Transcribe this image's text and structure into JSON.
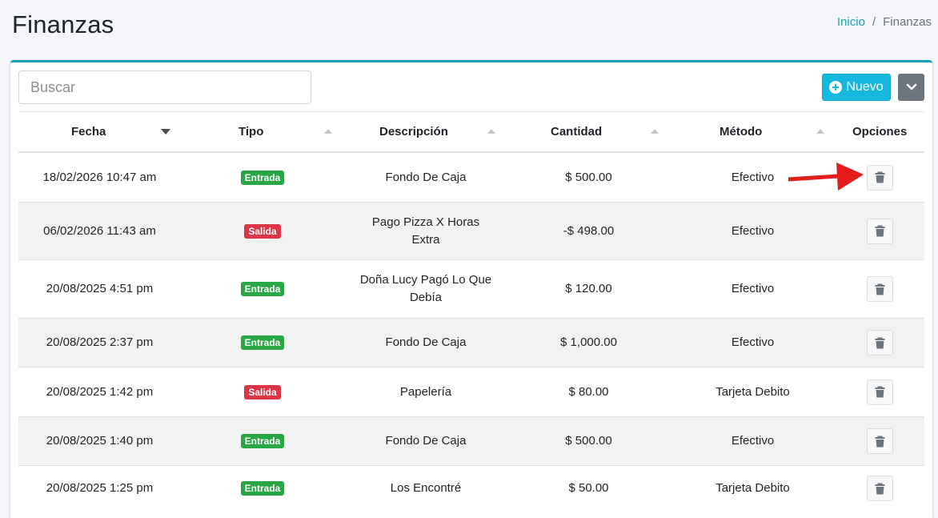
{
  "header": {
    "title": "Finanzas",
    "breadcrumb": {
      "home": "Inicio",
      "separator": "/",
      "current": "Finanzas"
    }
  },
  "toolbar": {
    "search_placeholder": "Buscar",
    "new_label": "Nuevo"
  },
  "table": {
    "columns": [
      "Fecha",
      "Tipo",
      "Descripción",
      "Cantidad",
      "Método",
      "Opciones"
    ],
    "rows": [
      {
        "fecha": "18/02/2026 10:47 am",
        "tipo": "Entrada",
        "descripcion_1": "Fondo De Caja",
        "descripcion_2": "",
        "cantidad": "$ 500.00",
        "metodo": "Efectivo"
      },
      {
        "fecha": "06/02/2026 11:43 am",
        "tipo": "Salida",
        "descripcion_1": "Pago Pizza X Horas",
        "descripcion_2": "Extra",
        "cantidad": "-$ 498.00",
        "metodo": "Efectivo"
      },
      {
        "fecha": "20/08/2025 4:51 pm",
        "tipo": "Entrada",
        "descripcion_1": "Doña Lucy Pagó Lo Que",
        "descripcion_2": "Debía",
        "cantidad": "$ 120.00",
        "metodo": "Efectivo"
      },
      {
        "fecha": "20/08/2025 2:37 pm",
        "tipo": "Entrada",
        "descripcion_1": "Fondo De Caja",
        "descripcion_2": "",
        "cantidad": "$ 1,000.00",
        "metodo": "Efectivo"
      },
      {
        "fecha": "20/08/2025 1:42 pm",
        "tipo": "Salida",
        "descripcion_1": "Papelería",
        "descripcion_2": "",
        "cantidad": "$ 80.00",
        "metodo": "Tarjeta Debito"
      },
      {
        "fecha": "20/08/2025 1:40 pm",
        "tipo": "Entrada",
        "descripcion_1": "Fondo De Caja",
        "descripcion_2": "",
        "cantidad": "$ 500.00",
        "metodo": "Efectivo"
      },
      {
        "fecha": "20/08/2025 1:25 pm",
        "tipo": "Entrada",
        "descripcion_1": "Los Encontré",
        "descripcion_2": "",
        "cantidad": "$ 50.00",
        "metodo": "Tarjeta Debito"
      }
    ]
  },
  "colors": {
    "accent": "#17a2b8",
    "new_button": "#17b8e0",
    "entrada_badge": "#28a745",
    "salida_badge": "#dc3545",
    "dropdown_button": "#6c757d",
    "annotation_arrow": "#e31b1b"
  },
  "icons": {
    "new_button_icon": "plus-circle-icon",
    "dropdown_icon": "chevron-down-icon",
    "row_action_icon": "trash-icon",
    "sort_active": "caret-down-icon",
    "sort_inactive": "caret-up-icon",
    "annotation": "red-arrow-icon"
  }
}
